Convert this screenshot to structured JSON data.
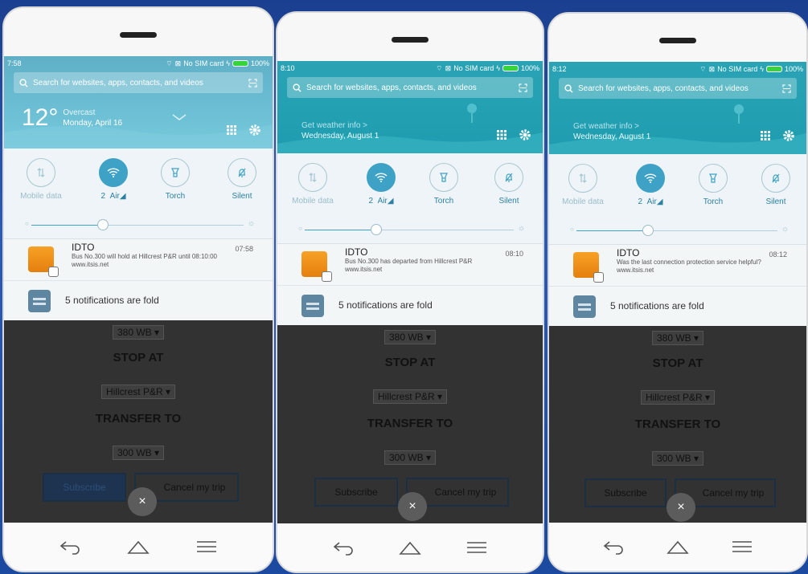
{
  "panel": {
    "search_placeholder": "Search for websites, apps, contacts, and videos",
    "no_sim": "No SIM card",
    "battery": "100%"
  },
  "toggles": {
    "mobile_data": "Mobile data",
    "airplane": "Air",
    "torch": "Torch",
    "silent": "Silent"
  },
  "screens": [
    {
      "time": "7:58",
      "weather_temp": "12°",
      "weather_cond": "Overcast",
      "weather_date": "Monday, April 16",
      "sim_num": "2",
      "notif_app": "IDTO",
      "notif_time": "07:58",
      "notif_body": "Bus No.300 will hold at Hillcrest P&R until 08:10:00",
      "notif_url": "www.itsis.net"
    },
    {
      "time": "8:10",
      "weather_link": "Get weather info >",
      "weather_date": "Wednesday, August 1",
      "sim_num": "2",
      "notif_app": "IDTO",
      "notif_time": "08:10",
      "notif_body": "Bus No.300 has departed from Hillcrest P&R",
      "notif_url": "www.itsis.net"
    },
    {
      "time": "8:12",
      "weather_link": "Get weather info >",
      "weather_date": "Wednesday, August 1",
      "sim_num": "2",
      "notif_app": "IDTO",
      "notif_time": "08:12",
      "notif_body": "Was the last connection protection service helpful?",
      "notif_url": "www.itsis.net"
    }
  ],
  "fold_text": "5 notifications are fold",
  "app": {
    "route_select": "380 WB",
    "stop_heading": "STOP AT",
    "stop_select": "Hillcrest P&R",
    "transfer_heading": "TRANSFER TO",
    "transfer_select": "300 WB",
    "subscribe_label": "Subscribe",
    "cancel_label": "Cancel my trip",
    "close_symbol": "×"
  },
  "colors": {
    "accent": "#3ea2c6",
    "battery_green": "#37d33b"
  }
}
